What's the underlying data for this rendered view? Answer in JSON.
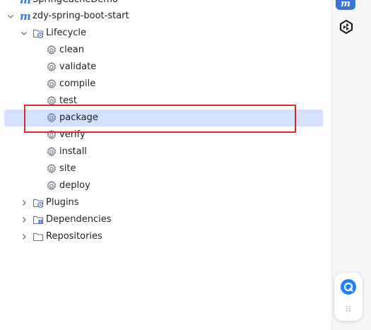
{
  "colors": {
    "accent": "#3c76d8",
    "selection": "#d5e1ff",
    "highlight_box": "#d62b2b",
    "float_button": "#1e82ff"
  },
  "tree": {
    "projects": [
      {
        "name": "SpringCacheDemo",
        "expanded": false,
        "icon": "maven-m-icon"
      },
      {
        "name": "zdy-spring-boot-start",
        "expanded": true,
        "icon": "maven-m-icon"
      }
    ],
    "lifecycle": {
      "label": "Lifecycle",
      "expanded": true,
      "icon": "lifecycle-folder-icon",
      "phases": [
        {
          "label": "clean",
          "icon": "gear-icon"
        },
        {
          "label": "validate",
          "icon": "gear-icon"
        },
        {
          "label": "compile",
          "icon": "gear-icon"
        },
        {
          "label": "test",
          "icon": "gear-icon"
        },
        {
          "label": "package",
          "icon": "gear-icon",
          "selected": true
        },
        {
          "label": "verify",
          "icon": "gear-icon"
        },
        {
          "label": "install",
          "icon": "gear-icon"
        },
        {
          "label": "site",
          "icon": "gear-icon"
        },
        {
          "label": "deploy",
          "icon": "gear-icon"
        }
      ]
    },
    "folders": [
      {
        "label": "Plugins",
        "icon": "plugins-folder-icon",
        "expanded": false
      },
      {
        "label": "Dependencies",
        "icon": "dependencies-folder-icon",
        "expanded": false
      },
      {
        "label": "Repositories",
        "icon": "repositories-folder-icon",
        "expanded": false
      }
    ]
  },
  "right_toolbar": {
    "maven_button": {
      "icon": "maven-m-icon",
      "label": "m"
    },
    "ai_button": {
      "icon": "ai-assistant-icon"
    },
    "floating_panel": {
      "button_icon": "chat-bubble-icon",
      "handle_icon": "drag-handle-icon"
    }
  }
}
